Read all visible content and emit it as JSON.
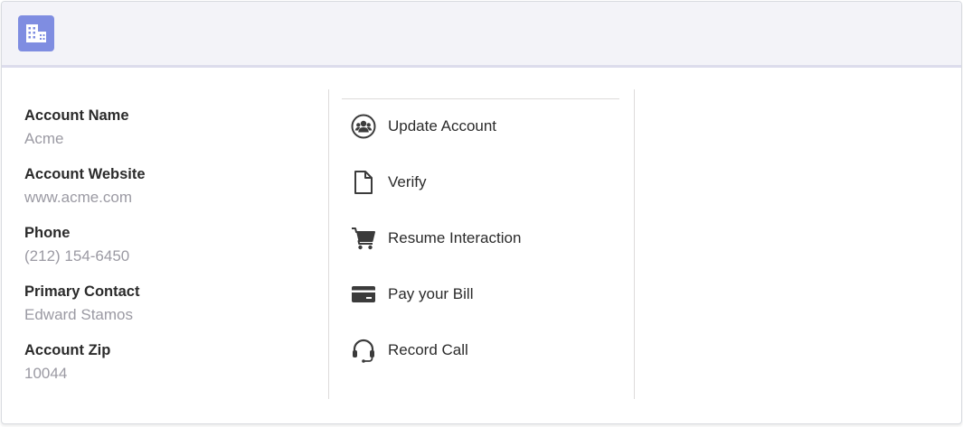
{
  "theme": {
    "accent": "#7f8de1",
    "icon_color": "#3b3b3b",
    "label_color": "#2b2b2b",
    "value_color": "#9b9aa3"
  },
  "header": {
    "icon": "building-icon"
  },
  "fields": [
    {
      "label": "Account Name",
      "value": "Acme"
    },
    {
      "label": "Account Website",
      "value": "www.acme.com"
    },
    {
      "label": "Phone",
      "value": "(212) 154-6450"
    },
    {
      "label": "Primary Contact",
      "value": "Edward Stamos"
    },
    {
      "label": "Account Zip",
      "value": "10044"
    }
  ],
  "actions": [
    {
      "label": "Update Account",
      "icon": "user-group-icon"
    },
    {
      "label": "Verify",
      "icon": "document-icon"
    },
    {
      "label": "Resume Interaction",
      "icon": "cart-icon"
    },
    {
      "label": "Pay your Bill",
      "icon": "credit-card-icon"
    },
    {
      "label": "Record Call",
      "icon": "headset-icon"
    }
  ]
}
